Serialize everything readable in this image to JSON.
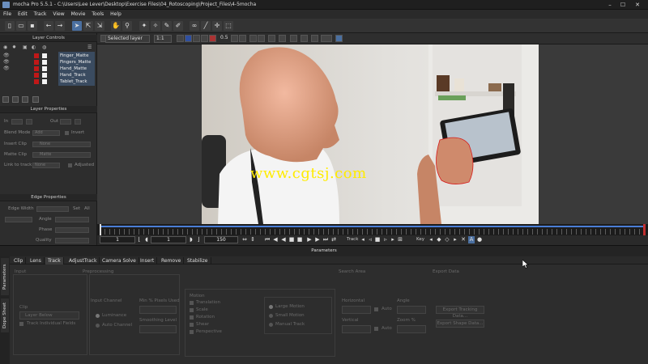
{
  "window": {
    "title": "mocha Pro 5.5.1 - C:\\Users\\Lee Lever\\Desktop\\Exercise Files\\04_Rotoscoping\\Project_Files\\4-5mocha"
  },
  "menu": [
    "File",
    "Edit",
    "Track",
    "View",
    "Movie",
    "Tools",
    "Help"
  ],
  "subtoolbar": {
    "layer_select": "Selected layer",
    "zoom": "1:1",
    "value": "0.5"
  },
  "layer_controls": {
    "title": "Layer Controls",
    "layers": [
      {
        "name": "Finger_Matte",
        "visible": true
      },
      {
        "name": "Fingers_Matte",
        "visible": true
      },
      {
        "name": "Hand_Matte",
        "visible": true
      },
      {
        "name": "Hand_Track",
        "visible": false
      },
      {
        "name": "Tablet_Track",
        "visible": false
      }
    ]
  },
  "layer_properties": {
    "title": "Layer Properties",
    "in_label": "In",
    "out_label": "Out",
    "blend_mode_label": "Blend Mode",
    "blend_mode_value": "Add",
    "invert_label": "Invert",
    "insert_clip_label": "Insert Clip",
    "insert_clip_value": "None",
    "matte_clip_label": "Matte Clip",
    "matte_clip_value": "Matte",
    "link_to_track_label": "Link to track",
    "link_to_track_value": "None",
    "adjusted_label": "Adjusted"
  },
  "edge_properties": {
    "title": "Edge Properties",
    "edge_width_label": "Edge Width",
    "set_label": "Set",
    "all_label": "All",
    "angle_label": "Angle",
    "phase_label": "Phase",
    "quality_label": "Quality"
  },
  "viewer": {
    "watermark": "www.cgtsj.com"
  },
  "timeline": {
    "in_frame": "1",
    "current_frame": "1",
    "out_frame": "150",
    "track_label": "Track",
    "key_label": "Key"
  },
  "parameters": {
    "title": "Parameters",
    "side_tabs": [
      "Parameters",
      "Dope Sheet"
    ],
    "tabs": [
      "Clip",
      "Lens",
      "Track",
      "AdjustTrack",
      "Camera Solve",
      "Insert",
      "Remove",
      "Stabilize"
    ],
    "active_tab": "Track",
    "groups": {
      "input": "Input",
      "preprocessing": "Preprocessing",
      "motion": "Motion",
      "search_area": "Search Area",
      "export_data": "Export Data"
    },
    "clip_label": "Clip",
    "clip_value": "Layer Below",
    "track_individual_fields": "Track Individual Fields",
    "input_channel": "Input Channel",
    "luminance": "Luminance",
    "auto_channel": "Auto Channel",
    "min_pixels_used": "Min % Pixels Used",
    "smoothing_level": "Smoothing Level",
    "motion_options": [
      "Translation",
      "Scale",
      "Rotation",
      "Shear",
      "Perspective"
    ],
    "motion_modes": [
      "Large Motion",
      "Small Motion",
      "Manual Track"
    ],
    "horizontal": "Horizontal",
    "vertical": "Vertical",
    "angle": "Angle",
    "zoom_pct": "Zoom %",
    "auto_label": "Auto",
    "export_tracking_data": "Export Tracking Data...",
    "export_shape_data": "Export Shape Data..."
  }
}
